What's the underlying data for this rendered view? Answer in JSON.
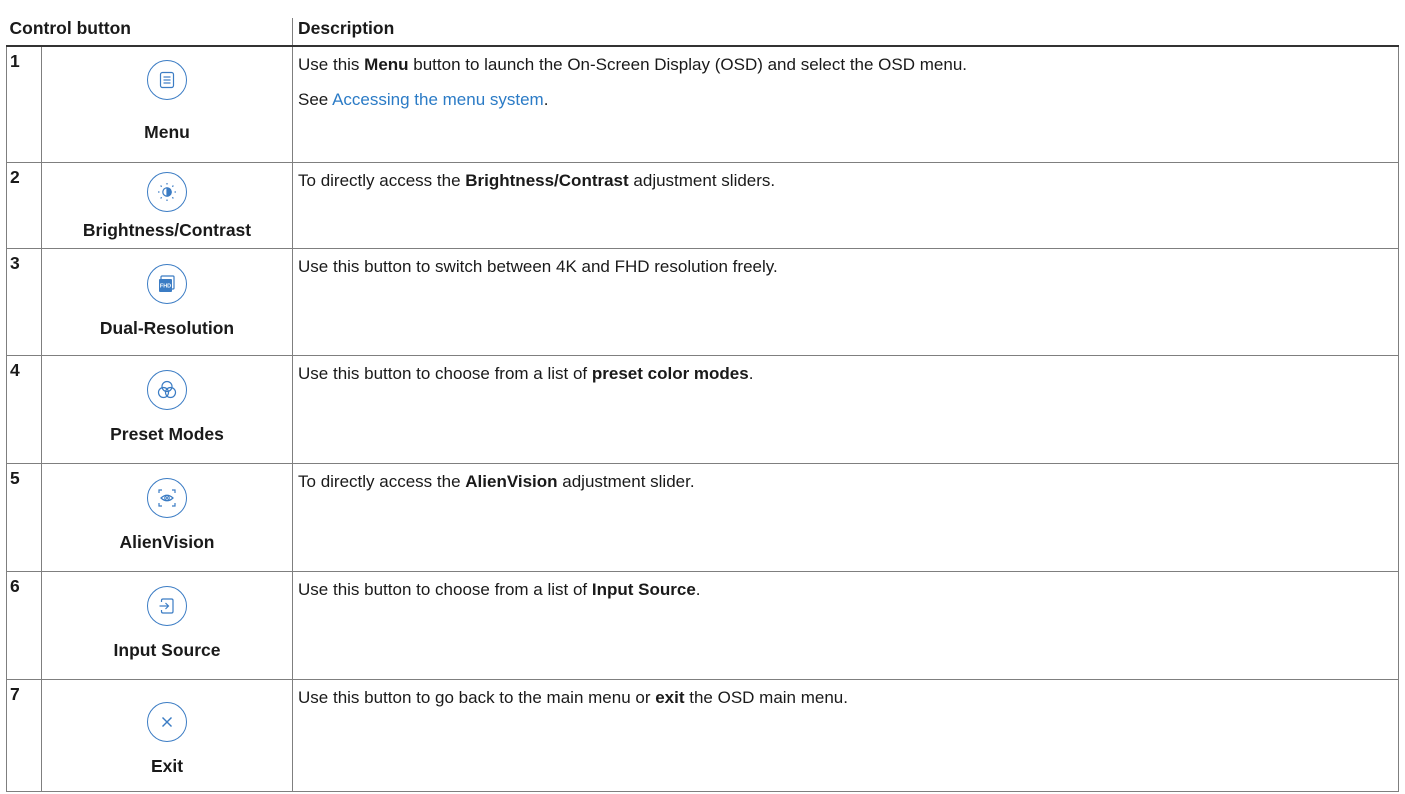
{
  "table": {
    "header": {
      "control_button": "Control button",
      "description": "Description"
    },
    "rows": [
      {
        "number": "1",
        "icon": "menu-icon",
        "label": "Menu",
        "desc_pre": "Use this ",
        "desc_bold": "Menu",
        "desc_post": " button to launch the On-Screen Display (OSD) and select the OSD menu.",
        "see_pre": "See ",
        "see_link": "Accessing the menu system",
        "see_post": "."
      },
      {
        "number": "2",
        "icon": "brightness-contrast-icon",
        "label": "Brightness/Contrast",
        "desc_pre": "To directly access the ",
        "desc_bold": "Brightness/Contrast",
        "desc_post": " adjustment sliders."
      },
      {
        "number": "3",
        "icon": "dual-resolution-icon",
        "icon_text": "FHD",
        "label": "Dual-Resolution",
        "desc": "Use this button to switch between 4K and FHD resolution freely."
      },
      {
        "number": "4",
        "icon": "preset-modes-icon",
        "label": "Preset Modes",
        "desc_pre": "Use this button to choose from a list of ",
        "desc_bold": "preset color modes",
        "desc_post": "."
      },
      {
        "number": "5",
        "icon": "alienvision-icon",
        "label": "AlienVision",
        "desc_pre": "To directly access the ",
        "desc_bold": "AlienVision",
        "desc_post": " adjustment slider."
      },
      {
        "number": "6",
        "icon": "input-source-icon",
        "label": "Input Source",
        "desc_pre": "Use this button to choose from a list of ",
        "desc_bold": "Input Source",
        "desc_post": "."
      },
      {
        "number": "7",
        "icon": "exit-icon",
        "label": "Exit",
        "desc_pre": "Use this button to go back to the main menu or ",
        "desc_bold": "exit",
        "desc_post": " the OSD main menu."
      }
    ]
  },
  "colors": {
    "icon_stroke": "#3b7cc4",
    "link": "#2b7bc6",
    "text": "#1a1a1a",
    "rule": "#7f7f7f"
  }
}
